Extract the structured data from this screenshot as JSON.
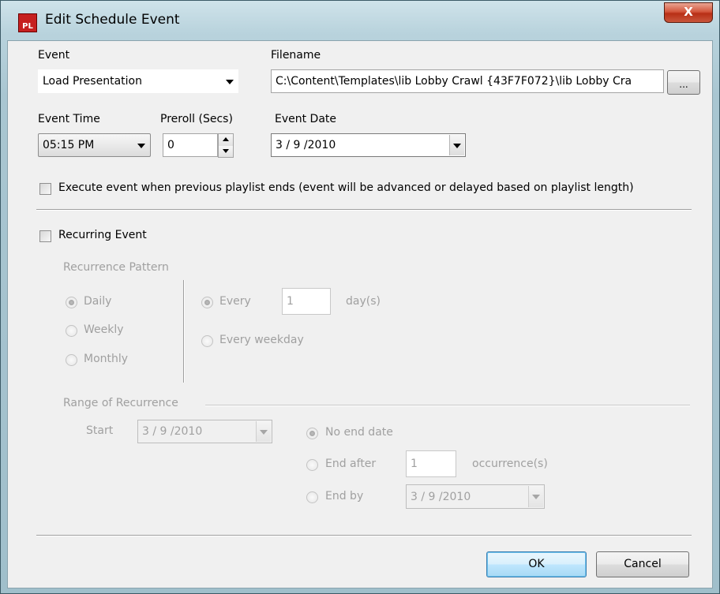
{
  "window": {
    "title": "Edit Schedule Event",
    "logo_text": "PL",
    "close_glyph": "X"
  },
  "event": {
    "label": "Event",
    "value": "Load Presentation"
  },
  "filename": {
    "label": "Filename",
    "value": "C:\\Content\\Templates\\lib Lobby Crawl {43F7F072}\\lib Lobby Cra",
    "browse_label": "..."
  },
  "event_time": {
    "label": "Event Time",
    "value": "05:15 PM"
  },
  "preroll": {
    "label": "Preroll (Secs)",
    "value": "0"
  },
  "event_date": {
    "label": "Event Date",
    "value": "3 / 9 /2010"
  },
  "execute_when_ends": {
    "label": "Execute event when previous playlist ends (event will be advanced or delayed based on playlist length)",
    "checked": false
  },
  "recurring": {
    "label": "Recurring Event",
    "checked": false,
    "pattern_label": "Recurrence Pattern",
    "pattern_options": [
      "Daily",
      "Weekly",
      "Monthly"
    ],
    "selected_pattern": "Daily",
    "every_label": "Every",
    "every_value": "1",
    "days_label": "day(s)",
    "every_weekday_label": "Every weekday"
  },
  "range": {
    "label": "Range of Recurrence",
    "start_label": "Start",
    "start_value": "3 / 9 /2010",
    "no_end_label": "No end date",
    "end_after_label": "End after",
    "end_after_value": "1",
    "occurrences_label": "occurrence(s)",
    "end_by_label": "End by",
    "end_by_value": "3 / 9 /2010"
  },
  "buttons": {
    "ok": "OK",
    "cancel": "Cancel"
  },
  "colors": {
    "title_gradient_top": "#cfe3ea",
    "close_red": "#c9563c",
    "dialog_bg": "#f0f0f0",
    "disabled_text": "#a0a0a0",
    "default_button_border": "#3c7fb1"
  }
}
